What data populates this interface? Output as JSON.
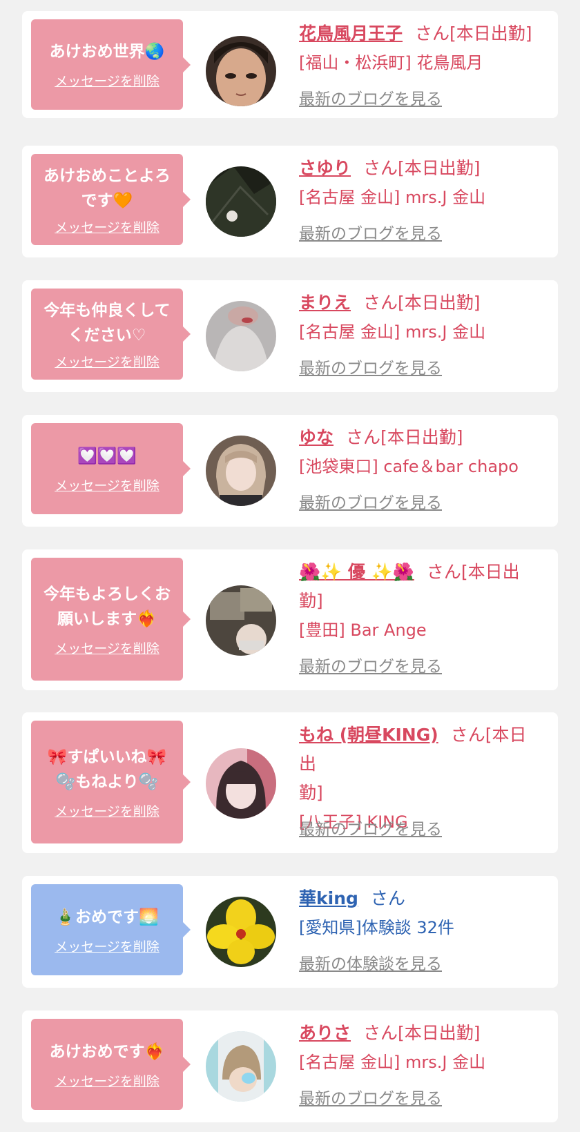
{
  "delete_label": "メッセージを削除",
  "colors": {
    "pink_bubble": "#ec99a6",
    "blue_bubble": "#9bb9ee",
    "name_red": "#d8485f",
    "name_blue": "#2e63b2"
  },
  "entries": [
    {
      "message_lines": [
        "あけおめ世界🌏"
      ],
      "name": "花鳥風月王子",
      "suffix": "さん[本日出勤]",
      "shop": "[福山・松浜町] 花鳥風月",
      "link": "最新のブログを見る"
    },
    {
      "message_lines": [
        "あけおめことよろ",
        "です🧡"
      ],
      "name": "さゆり",
      "suffix": "さん[本日出勤]",
      "shop": "[名古屋 金山] mrs.J 金山",
      "link": "最新のブログを見る"
    },
    {
      "message_lines": [
        "今年も仲良くして",
        "ください♡"
      ],
      "name": "まりえ",
      "suffix": "さん[本日出勤]",
      "shop": "[名古屋 金山] mrs.J 金山",
      "link": "最新のブログを見る"
    },
    {
      "message_lines": [
        "💟💟💟"
      ],
      "name": "ゆな",
      "suffix": "さん[本日出勤]",
      "shop": "[池袋東口] cafe＆bar chapo",
      "link": "最新のブログを見る"
    },
    {
      "message_lines": [
        "今年もよろしくお",
        "願いします❤️‍🔥"
      ],
      "name": "🌺✨ 優 ✨🌺",
      "suffix": "さん[本日出",
      "suffix2": "勤]",
      "shop": "[豊田] Bar Ange",
      "link": "最新のブログを見る"
    },
    {
      "message_lines": [
        "🎀すぱいいね🎀",
        "🫧もねより🫧"
      ],
      "name": "もね (朝昼KING)",
      "suffix": "さん[本日出",
      "suffix2": "勤]",
      "shop": "[八王子] KING",
      "link": "最新のブログを見る"
    },
    {
      "message_lines": [
        "🎍おめです🌅"
      ],
      "name": "華king",
      "suffix": "さん",
      "shop": "[愛知県]体験談 32件",
      "link": "最新の体験談を見る"
    },
    {
      "message_lines": [
        "あけおめです❤️‍🔥"
      ],
      "name": "ありさ",
      "suffix": "さん[本日出勤]",
      "shop": "[名古屋 金山] mrs.J 金山",
      "link": "最新のブログを見る"
    }
  ]
}
